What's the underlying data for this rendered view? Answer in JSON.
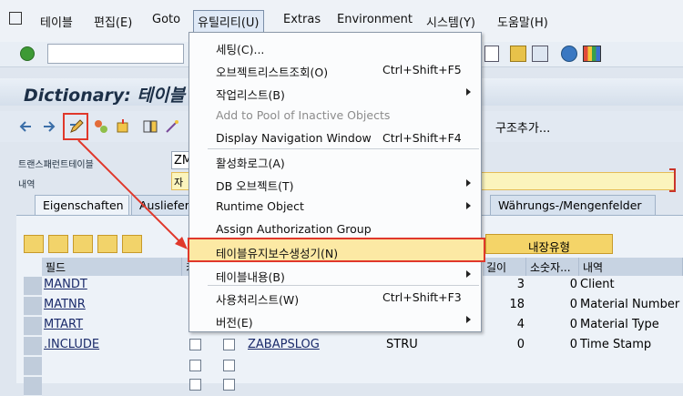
{
  "menubar": {
    "items": [
      "테이블",
      "편집(E)",
      "Goto",
      "유틸리티(U)",
      "Extras",
      "Environment",
      "시스템(Y)",
      "도움말(H)"
    ]
  },
  "title": "Dictionary: 테이블 -",
  "fields": {
    "delivery_class_label": "트랜스패런트테이블",
    "delivery_class_value": "ZM",
    "description_label": "내역",
    "description_value": "자재"
  },
  "toolbar": {
    "structure_add": "구조추가..."
  },
  "tabs": [
    "Eigenschaften",
    "Auslieferu",
    "Währungs-/Mengenfelder"
  ],
  "table": {
    "builtin_type_label": "내장유형",
    "headers": {
      "field": "필드",
      "key": "키",
      "length": "길이",
      "decimals": "소숫자...",
      "description": "내역"
    },
    "rows": [
      {
        "field": "MANDT",
        "data_element": "",
        "type": "",
        "length": "3",
        "decimals": "0",
        "description": "Client"
      },
      {
        "field": "MATNR",
        "data_element": "",
        "type": "",
        "length": "18",
        "decimals": "0",
        "description": "Material Number"
      },
      {
        "field": "MTART",
        "data_element": "",
        "type": "",
        "length": "4",
        "decimals": "0",
        "description": "Material Type"
      },
      {
        "field": ".INCLUDE",
        "data_element": "ZABAPSLOG",
        "type": "STRU",
        "length": "0",
        "decimals": "0",
        "description": "Time Stamp"
      }
    ]
  },
  "menu": {
    "items": [
      {
        "label": "세팅(C)...",
        "shortcut": ""
      },
      {
        "label": "오브젝트리스트조회(O)",
        "shortcut": "Ctrl+Shift+F5"
      },
      {
        "label": "작업리스트(B)",
        "shortcut": ""
      },
      {
        "label": "Add to Pool of Inactive Objects",
        "shortcut": ""
      },
      {
        "label": "Display Navigation Window",
        "shortcut": "Ctrl+Shift+F4"
      },
      {
        "label": "활성화로그(A)",
        "shortcut": ""
      },
      {
        "label": "DB 오브젝트(T)",
        "shortcut": ""
      },
      {
        "label": "Runtime Object",
        "shortcut": ""
      },
      {
        "label": "Assign Authorization Group",
        "shortcut": ""
      },
      {
        "label": "테이블유지보수생성기(N)",
        "shortcut": ""
      },
      {
        "label": "테이블내용(B)",
        "shortcut": ""
      },
      {
        "label": "사용처리스트(W)",
        "shortcut": "Ctrl+Shift+F3"
      },
      {
        "label": "버전(E)",
        "shortcut": ""
      }
    ]
  },
  "colors": {
    "highlight_border": "#e0382b",
    "highlight_fill": "#fce9a4",
    "title_text": "#1c2f47"
  }
}
